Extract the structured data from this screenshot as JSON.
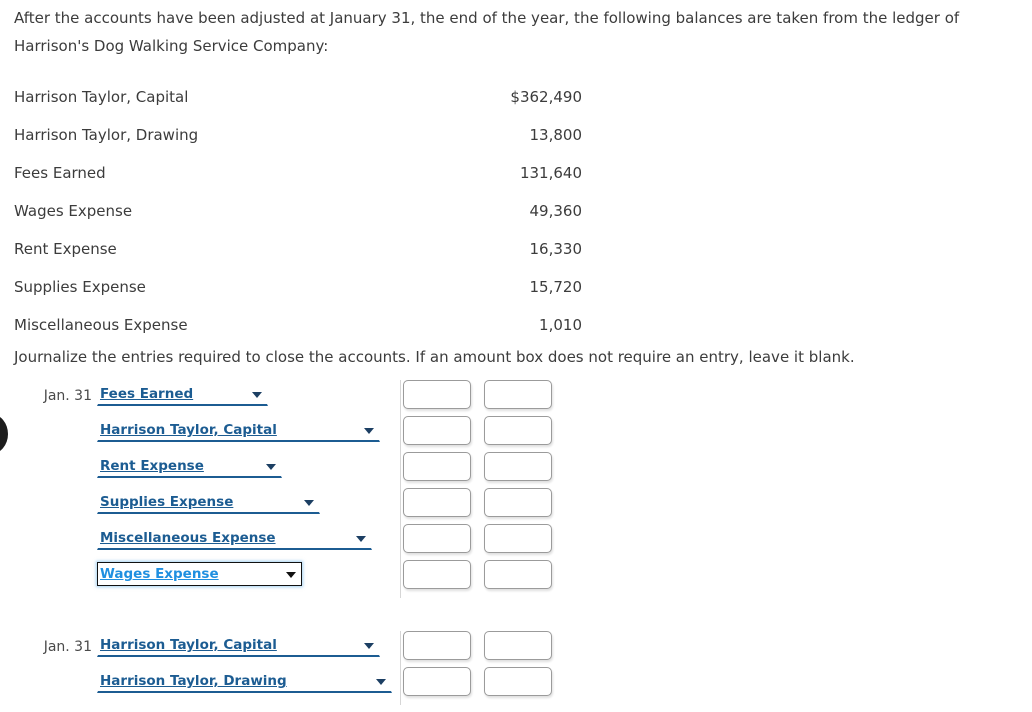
{
  "problem": {
    "intro": "After the accounts have been adjusted at January 31, the end of the year, the following balances are taken from the ledger of Harrison's Dog Walking Service Company:",
    "instruction": "Journalize the entries required to close the accounts. If an amount box does not require an entry, leave it blank."
  },
  "balances": {
    "rows": [
      {
        "account": "Harrison Taylor, Capital",
        "amount": "$362,490"
      },
      {
        "account": "Harrison Taylor, Drawing",
        "amount": "13,800"
      },
      {
        "account": "Fees Earned",
        "amount": "131,640"
      },
      {
        "account": "Wages Expense",
        "amount": "49,360"
      },
      {
        "account": "Rent Expense",
        "amount": "16,330"
      },
      {
        "account": "Supplies Expense",
        "amount": "15,720"
      },
      {
        "account": "Miscellaneous Expense",
        "amount": "1,010"
      }
    ]
  },
  "journal": {
    "entries": [
      {
        "date": "Jan. 31",
        "lines": [
          {
            "date": "Jan. 31",
            "account": "Fees Earned",
            "select_width": 171,
            "focused": false,
            "debit": "",
            "credit": ""
          },
          {
            "date": "",
            "account": "Harrison Taylor, Capital",
            "select_width": 283,
            "focused": false,
            "debit": "",
            "credit": ""
          },
          {
            "date": "",
            "account": "Rent Expense",
            "select_width": 185,
            "focused": false,
            "debit": "",
            "credit": ""
          },
          {
            "date": "",
            "account": "Supplies Expense",
            "select_width": 223,
            "focused": false,
            "debit": "",
            "credit": ""
          },
          {
            "date": "",
            "account": "Miscellaneous Expense",
            "select_width": 275,
            "focused": false,
            "debit": "",
            "credit": ""
          },
          {
            "date": "",
            "account": "Wages Expense",
            "select_width": 205,
            "focused": true,
            "debit": "",
            "credit": ""
          }
        ]
      },
      {
        "date": "Jan. 31",
        "lines": [
          {
            "date": "Jan. 31",
            "account": "Harrison Taylor, Capital",
            "select_width": 283,
            "focused": false,
            "debit": "",
            "credit": ""
          },
          {
            "date": "",
            "account": "Harrison Taylor, Drawing",
            "select_width": 295,
            "focused": false,
            "debit": "",
            "credit": ""
          }
        ]
      }
    ],
    "amount_placeholder": ""
  },
  "colors": {
    "link_blue": "#1c5c92",
    "focus_blue": "#1f8fe0",
    "body_text": "#3c3c3c",
    "box_border": "#9b9b9b"
  }
}
